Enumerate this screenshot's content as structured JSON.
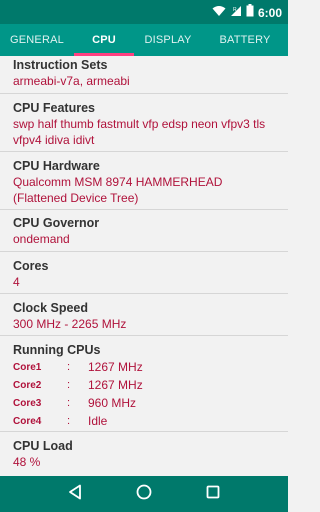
{
  "status_bar": {
    "time": "6:00"
  },
  "tabs": [
    {
      "label": "GENERAL",
      "active": false
    },
    {
      "label": "CPU",
      "active": true
    },
    {
      "label": "DISPLAY",
      "active": false
    },
    {
      "label": "BATTERY",
      "active": false
    }
  ],
  "sections": {
    "instruction_sets": {
      "title": "Instruction Sets",
      "value": "armeabi-v7a, armeabi"
    },
    "cpu_features": {
      "title": "CPU Features",
      "value": "swp half thumb fastmult vfp edsp neon vfpv3 tls vfpv4 idiva idivt"
    },
    "cpu_hardware": {
      "title": "CPU Hardware",
      "value": "Qualcomm MSM 8974 HAMMERHEAD (Flattened Device Tree)"
    },
    "cpu_governor": {
      "title": "CPU Governor",
      "value": "ondemand"
    },
    "cores": {
      "title": "Cores",
      "value": "4"
    },
    "clock_speed": {
      "title": "Clock Speed",
      "value": "300 MHz - 2265 MHz"
    },
    "running_cpus": {
      "title": "Running CPUs",
      "separator": ":",
      "cores": [
        {
          "name": "Core1",
          "value": "1267 MHz"
        },
        {
          "name": "Core2",
          "value": "1267 MHz"
        },
        {
          "name": "Core3",
          "value": "960 MHz"
        },
        {
          "name": "Core4",
          "value": "Idle"
        }
      ]
    },
    "cpu_load": {
      "title": "CPU Load",
      "value": "48 %"
    }
  },
  "icons": {
    "status": [
      "wifi-icon",
      "signal-icon",
      "battery-icon"
    ],
    "nav": [
      "back-icon",
      "home-icon",
      "recents-icon"
    ]
  },
  "colors": {
    "status_bar": "#00796b",
    "tab_bar": "#009688",
    "tab_indicator": "#ff4081",
    "value_text": "#b0123b",
    "background": "#f2f2f2"
  }
}
